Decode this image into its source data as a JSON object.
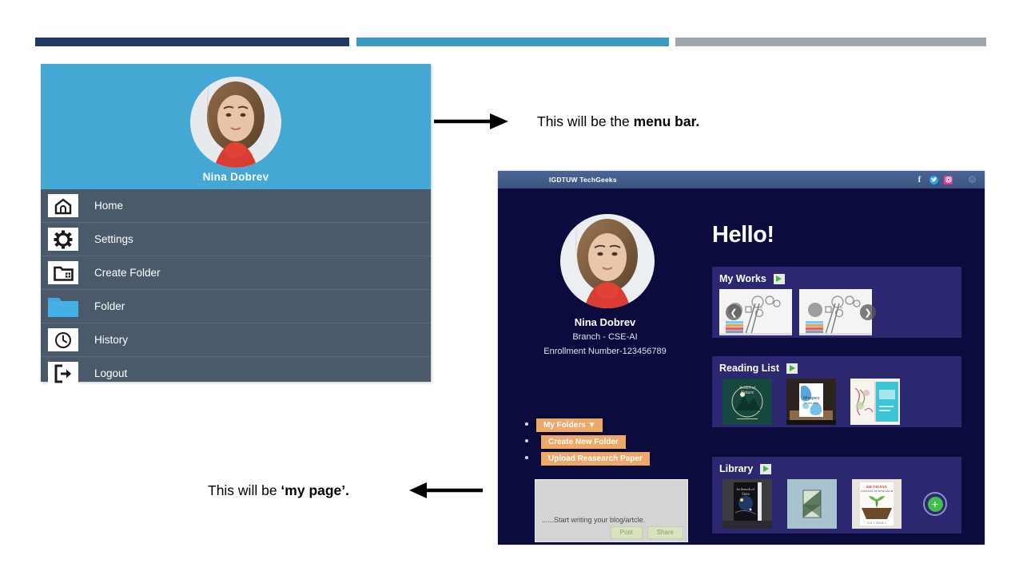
{
  "slide": {
    "decor_bars": [
      {
        "name": "navy-bar",
        "color": "#1f3864"
      },
      {
        "name": "blue-bar",
        "color": "#3d9ac4"
      },
      {
        "name": "gray-bar",
        "color": "#9fa6ad"
      }
    ]
  },
  "annotations": {
    "menu_bar": {
      "prefix": "This will be the ",
      "emphasis": "menu bar."
    },
    "my_page": {
      "prefix": "This will be ",
      "emphasis": "‘my page’."
    }
  },
  "sidebar_mock": {
    "profile_name": "Nina  Dobrev",
    "avatar_icon": "user-photo",
    "items": [
      {
        "label": "Home",
        "icon": "home-icon"
      },
      {
        "label": "Settings",
        "icon": "gear-icon"
      },
      {
        "label": "Create Folder",
        "icon": "folder-plus-icon"
      },
      {
        "label": "Folder",
        "icon": "folder-icon"
      },
      {
        "label": "History",
        "icon": "clock-icon"
      },
      {
        "label": "Logout",
        "icon": "logout-icon"
      }
    ]
  },
  "app": {
    "header": {
      "title": "IGDTUW TechGeeks",
      "social": [
        {
          "name": "facebook-icon",
          "glyph": "f"
        },
        {
          "name": "twitter-icon",
          "glyph": "✉"
        },
        {
          "name": "instagram-icon",
          "glyph": "▣"
        }
      ],
      "settings_icon": "gear-icon",
      "settings_glyph": "⚙"
    },
    "profile": {
      "avatar_icon": "user-photo",
      "name": "Nina Dobrev",
      "branch": "Branch - CSE-AI",
      "enrollment": "Enrollment Number-123456789",
      "actions": [
        {
          "label": "My Folders ▼",
          "name": "my-folders-button"
        },
        {
          "label": "Create New Folder",
          "name": "create-new-folder-button"
        },
        {
          "label": "Upload Reasearch Paper",
          "name": "upload-research-paper-button"
        }
      ]
    },
    "blog": {
      "placeholder": "......Start writing your blog/artcle.",
      "post_label": "Post",
      "share_label": "Share"
    },
    "greeting": "Hello!",
    "panels": [
      {
        "title": "My Works",
        "play_icon": "play-icon",
        "prev_glyph": "❮",
        "next_glyph": "❯",
        "items": [
          "work-thumbnail-1",
          "work-thumbnail-2"
        ]
      },
      {
        "title": "Reading List",
        "play_icon": "play-icon",
        "items": [
          "book-cover-branch-of-nature",
          "book-cover-blue-floral",
          "book-cover-open-magazine"
        ]
      },
      {
        "title": "Library",
        "play_icon": "play-icon",
        "items": [
          "book-cover-space",
          "book-cover-green-folded",
          "book-cover-sprout"
        ],
        "add_glyph": "+"
      }
    ]
  },
  "colors": {
    "navy": "#1f3864",
    "blue": "#3d9ac4",
    "gray": "#9fa6ad",
    "sidebar_body": "#4a5a6b",
    "sidebar_header": "#45a8d4",
    "app_bg": "#0c0b3d",
    "panel_bg": "#2b2870",
    "accent_orange": "#f0a868",
    "accent_green": "#3fc14f"
  }
}
